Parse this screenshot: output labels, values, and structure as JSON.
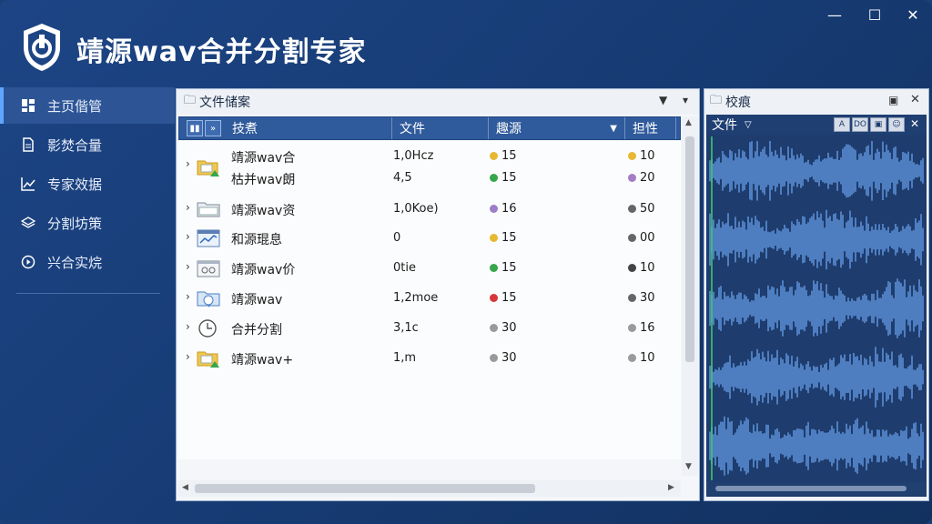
{
  "app": {
    "title": "靖源wav合并分割专家"
  },
  "window": {
    "minimize": "—",
    "maximize": "☐",
    "close": "✕"
  },
  "sidebar": {
    "items": [
      {
        "label": "主页偕管",
        "icon": "dashboard-icon",
        "active": true
      },
      {
        "label": "影焚合量",
        "icon": "document-icon",
        "active": false
      },
      {
        "label": "专家效据",
        "icon": "chart-icon",
        "active": false
      },
      {
        "label": "分割坊策",
        "icon": "layers-icon",
        "active": false
      },
      {
        "label": "兴合实烷",
        "icon": "play-circle-icon",
        "active": false
      }
    ]
  },
  "file_panel": {
    "title": "文件储案",
    "columns": {
      "name": "技煮",
      "size": "文件",
      "source": "趣源",
      "attr": "担性"
    },
    "rows": [
      {
        "name": "靖源wav合",
        "name2": "枯并wav朗",
        "size": "1,0Hcz",
        "size2": "4,5",
        "src_color": "#e6b833",
        "src": "15",
        "src2_color": "#36a64a",
        "src2": "15",
        "attr_color": "#e6b833",
        "attr": "10",
        "attr2_color": "#a57dc4",
        "attr2": "20",
        "icon": "folder-image-icon"
      },
      {
        "name": "靖源wav资",
        "size": "1,0Koe)",
        "src_color": "#9b7ec8",
        "src": "16",
        "attr_color": "#666666",
        "attr": "50",
        "icon": "folder-icon"
      },
      {
        "name": "和源琨息",
        "size": "0",
        "src_color": "#e6b833",
        "src": "15",
        "attr_color": "#666666",
        "attr": "00",
        "icon": "chart-window-icon"
      },
      {
        "name": "靖源wav价",
        "size": "0tie",
        "src_color": "#36a64a",
        "src": "15",
        "attr_color": "#444444",
        "attr": "10",
        "icon": "settings-window-icon"
      },
      {
        "name": "靖源wav",
        "size": "1,2moe",
        "src_color": "#d6373a",
        "src": "15",
        "attr_color": "#666666",
        "attr": "30",
        "icon": "chat-folder-icon"
      },
      {
        "name": "合并分割",
        "size": "3,1c",
        "src_color": "#9a9a9a",
        "src": "30",
        "attr_color": "#9a9a9a",
        "attr": "16",
        "icon": "clock-icon"
      },
      {
        "name": "靖源wav+",
        "size": "1,m",
        "src_color": "#9a9a9a",
        "src": "30",
        "attr_color": "#9a9a9a",
        "attr": "10",
        "icon": "folder-add-icon"
      }
    ]
  },
  "preview_panel": {
    "title": "校痕",
    "wave_label": "文件",
    "tool_buttons": [
      "A",
      "DO",
      "▣",
      "☺"
    ]
  },
  "colors": {
    "accent": "#2f5a9b",
    "sidebar_active": "#2d5596",
    "waveform": "#5b8fd6"
  }
}
